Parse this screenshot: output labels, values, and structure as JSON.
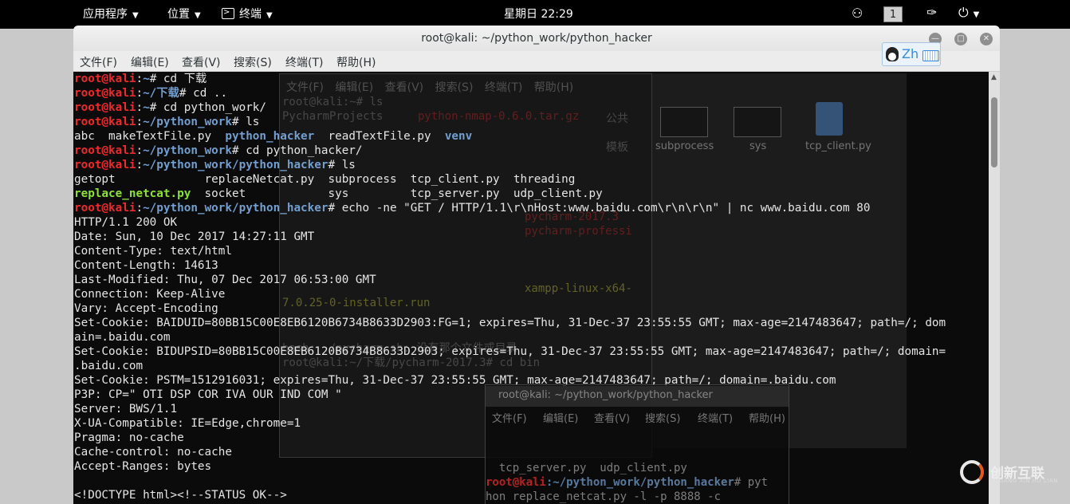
{
  "topbar": {
    "apps": "应用程序",
    "places": "位置",
    "terminal": "终端",
    "clock": "星期日 22:29",
    "workspace": "1"
  },
  "window": {
    "title": "root@kali: ~/python_work/python_hacker",
    "menu": [
      "文件(F)",
      "编辑(E)",
      "查看(V)",
      "搜索(S)",
      "终端(T)",
      "帮助(H)"
    ],
    "ime": "Zh"
  },
  "terminal_lines": [
    [
      [
        "u",
        "root@kali"
      ],
      [
        "t",
        ":"
      ],
      [
        "p",
        "~"
      ],
      [
        "t",
        "# cd 下载"
      ]
    ],
    [
      [
        "u",
        "root@kali"
      ],
      [
        "t",
        ":"
      ],
      [
        "p",
        "~/下载"
      ],
      [
        "t",
        "# cd .."
      ]
    ],
    [
      [
        "u",
        "root@kali"
      ],
      [
        "t",
        ":"
      ],
      [
        "p",
        "~"
      ],
      [
        "t",
        "# cd python_work/"
      ]
    ],
    [
      [
        "u",
        "root@kali"
      ],
      [
        "t",
        ":"
      ],
      [
        "p",
        "~/python_work"
      ],
      [
        "t",
        "# ls"
      ]
    ],
    [
      [
        "t",
        "abc  makeTextFile.py  "
      ],
      [
        "d",
        "python_hacker"
      ],
      [
        "t",
        "  readTextFile.py  "
      ],
      [
        "d",
        "venv"
      ]
    ],
    [
      [
        "u",
        "root@kali"
      ],
      [
        "t",
        ":"
      ],
      [
        "p",
        "~/python_work"
      ],
      [
        "t",
        "# cd python_hacker/"
      ]
    ],
    [
      [
        "u",
        "root@kali"
      ],
      [
        "t",
        ":"
      ],
      [
        "p",
        "~/python_work/python_hacker"
      ],
      [
        "t",
        "# ls"
      ]
    ],
    [
      [
        "t",
        "getopt             replaceNetcat.py  subprocess  tcp_client.py  threading"
      ]
    ],
    [
      [
        "x",
        "replace_netcat.py"
      ],
      [
        "t",
        "  socket            sys         tcp_server.py  udp_client.py"
      ]
    ],
    [
      [
        "u",
        "root@kali"
      ],
      [
        "t",
        ":"
      ],
      [
        "p",
        "~/python_work/python_hacker"
      ],
      [
        "t",
        "# echo -ne \"GET / HTTP/1.1\\r\\nHost:www.baidu.com\\r\\n\\r\\n\" | nc www.baidu.com 80"
      ]
    ],
    [
      [
        "t",
        "HTTP/1.1 200 OK"
      ]
    ],
    [
      [
        "t",
        "Date: Sun, 10 Dec 2017 14:27:11 GMT"
      ]
    ],
    [
      [
        "t",
        "Content-Type: text/html"
      ]
    ],
    [
      [
        "t",
        "Content-Length: 14613"
      ]
    ],
    [
      [
        "t",
        "Last-Modified: Thu, 07 Dec 2017 06:53:00 GMT"
      ]
    ],
    [
      [
        "t",
        "Connection: Keep-Alive"
      ]
    ],
    [
      [
        "t",
        "Vary: Accept-Encoding"
      ]
    ],
    [
      [
        "t",
        "Set-Cookie: BAIDUID=80BB15C00E8EB6120B6734B8633D2903:FG=1; expires=Thu, 31-Dec-37 23:55:55 GMT; max-age=2147483647; path=/; dom"
      ]
    ],
    [
      [
        "t",
        "ain=.baidu.com"
      ]
    ],
    [
      [
        "t",
        "Set-Cookie: BIDUPSID=80BB15C00E8EB6120B6734B8633D2903; expires=Thu, 31-Dec-37 23:55:55 GMT; max-age=2147483647; path=/; domain="
      ]
    ],
    [
      [
        "t",
        ".baidu.com"
      ]
    ],
    [
      [
        "t",
        "Set-Cookie: PSTM=1512916031; expires=Thu, 31-Dec-37 23:55:55 GMT; max-age=2147483647; path=/; domain=.baidu.com"
      ]
    ],
    [
      [
        "t",
        "P3P: CP=\" OTI DSP COR IVA OUR IND COM \""
      ]
    ],
    [
      [
        "t",
        "Server: BWS/1.1"
      ]
    ],
    [
      [
        "t",
        "X-UA-Compatible: IE=Edge,chrome=1"
      ]
    ],
    [
      [
        "t",
        "Pragma: no-cache"
      ]
    ],
    [
      [
        "t",
        "Cache-control: no-cache"
      ]
    ],
    [
      [
        "t",
        "Accept-Ranges: bytes"
      ]
    ],
    [
      [
        "t",
        ""
      ]
    ],
    [
      [
        "t",
        "<!DOCTYPE html><!--STATUS OK-->"
      ]
    ]
  ],
  "background_filemanager": {
    "items": [
      "subprocess",
      "sys",
      "tcp_client.py"
    ]
  },
  "ghost_text": {
    "a": "root@kali:~# ls",
    "b": "PycharmProjects",
    "c": "python-nmap-0.6.0.tar.gz",
    "d": "公共",
    "e": "模板",
    "f": "pycharm-2017.3",
    "g": "pycharm-professi",
    "h": "xampp-linux-x64-",
    "i": "7.0.25-0-installer.run",
    "j": "bash: ./pycharm.sh: 没有那个文件或目录",
    "k": "root@kali:~/下载/pycharm-2017.3# cd bin"
  },
  "mini_terminal": {
    "title": "root@kali: ~/python_work/python_hacker",
    "menu": [
      "文件(F)",
      "编辑(E)",
      "查看(V)",
      "搜索(S)",
      "终端(T)",
      "帮助(H)"
    ],
    "line1": "  tcp_server.py  udp_client.py",
    "line2_user": "root@kali",
    "line2_path": ":~/python_work/python_hacker",
    "line2_tail": "# pyt",
    "line3": "hon replace_netcat.py -l -p 8888 -c"
  },
  "watermark": {
    "name": "创新互联",
    "sub": "CHUANG XIN HU LIAN"
  },
  "colors": {
    "user": "#ef2929",
    "path": "#729fcf",
    "executable": "#8ae234",
    "terminal_bg": "#0b0b0b",
    "text": "#e5e5e5"
  }
}
